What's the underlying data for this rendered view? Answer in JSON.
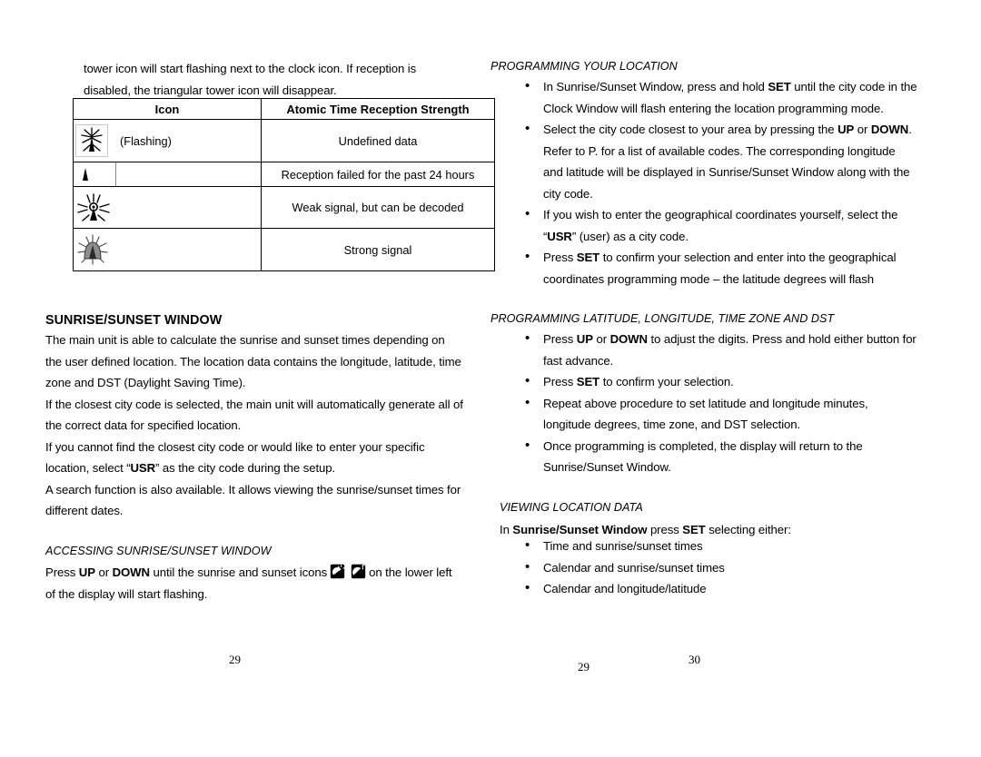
{
  "left_column": {
    "intro_paragraph": {
      "line1": "tower icon will start flashing next to the clock icon. If reception is",
      "line2": "disabled, the triangular tower icon will disappear."
    },
    "table": {
      "headers": [
        "Icon",
        "Atomic Time Reception Strength"
      ],
      "rows": [
        {
          "icon_name": "tower-flashing-icon",
          "icon_note": "(Flashing)",
          "description": "Undefined data"
        },
        {
          "icon_name": "tower-triangle-icon",
          "icon_note": "",
          "description": "Reception failed for the past 24 hours"
        },
        {
          "icon_name": "tower-weak-signal-icon",
          "icon_note": "",
          "description": "Weak signal, but can be decoded"
        },
        {
          "icon_name": "tower-strong-signal-icon",
          "icon_note": "",
          "description": "Strong signal"
        }
      ]
    },
    "sunrise_sunset": {
      "heading": "SUNRISE/SUNSET WINDOW",
      "paragraphs": [
        "The main unit is able to calculate the sunrise and sunset times depending on the user defined location. The location data contains the longitude, latitude, time zone and DST (Daylight Saving Time).",
        "If the closest city code is selected, the main unit will automatically generate all of the correct data for specified location."
      ],
      "para3_pre": "If you cannot find the closest city code or would like to enter your specific location, select “",
      "para3_bold": "USR",
      "para3_post": "” as the city code during the setup.",
      "para4": "A search function is also available. It allows viewing the sunrise/sunset times for different dates."
    },
    "accessing": {
      "heading": "ACCESSING SUNRISE/SUNSET WINDOW",
      "text_pre": "Press ",
      "bold_up": "UP",
      "text_or": " or ",
      "bold_down": "DOWN",
      "text_mid": " until the sunrise and sunset icons",
      "icon1_name": "sunrise-icon",
      "icon2_name": "sunset-icon",
      "text_post": "on the lower left of the display will start flashing."
    }
  },
  "right_column": {
    "programming_location": {
      "heading": "PROGRAMMING YOUR LOCATION",
      "bullets": [
        {
          "pre": "In Sunrise/Sunset Window, press and hold ",
          "bold": "SET",
          "post": " until the city code in the Clock Window will flash entering the location programming mode."
        },
        {
          "pre": "Select the city code closest to your area by pressing the ",
          "bold": "UP",
          "mid": " or ",
          "bold2": "DOWN",
          "post": ". Refer to P. for a list of available codes. The corresponding longitude and latitude will be displayed in Sunrise/Sunset Window along with the city code."
        },
        {
          "pre": "If you wish to enter the geographical coordinates yourself, select the “",
          "bold": "USR",
          "post": "” (user) as a city code."
        },
        {
          "pre": "Press ",
          "bold": "SET",
          "post": " to confirm your selection and enter into the geographical coordinates programming mode – the latitude degrees will flash"
        }
      ]
    },
    "programming_latlon": {
      "heading": "PROGRAMMING LATITUDE, LONGITUDE, TIME ZONE AND DST",
      "bullets": [
        {
          "pre": "Press ",
          "bold": "UP",
          "mid": " or ",
          "bold2": "DOWN",
          "post": " to adjust the digits. Press and hold either button for fast advance."
        },
        {
          "pre": "Press ",
          "bold": "SET",
          "post": " to confirm your selection."
        },
        {
          "pre": "Repeat above procedure to set latitude and longitude minutes, longitude degrees, time zone, and DST selection.",
          "bold": "",
          "post": ""
        },
        {
          "pre": "Once programming is completed, the display will return to the Sunrise/Sunset Window.",
          "bold": "",
          "post": ""
        }
      ]
    },
    "viewing_location": {
      "heading": "VIEWING LOCATION DATA",
      "intro_pre": "In ",
      "intro_bold1": "Sunrise/Sunset Window",
      "intro_mid": " press ",
      "intro_bold2": "SET",
      "intro_post": " selecting either:",
      "bullets": [
        "Time and sunrise/sunset times",
        "Calendar and sunrise/sunset times",
        "Calendar and longitude/latitude"
      ]
    }
  },
  "page_numbers": {
    "left": "29",
    "center": "29",
    "right": "30"
  }
}
